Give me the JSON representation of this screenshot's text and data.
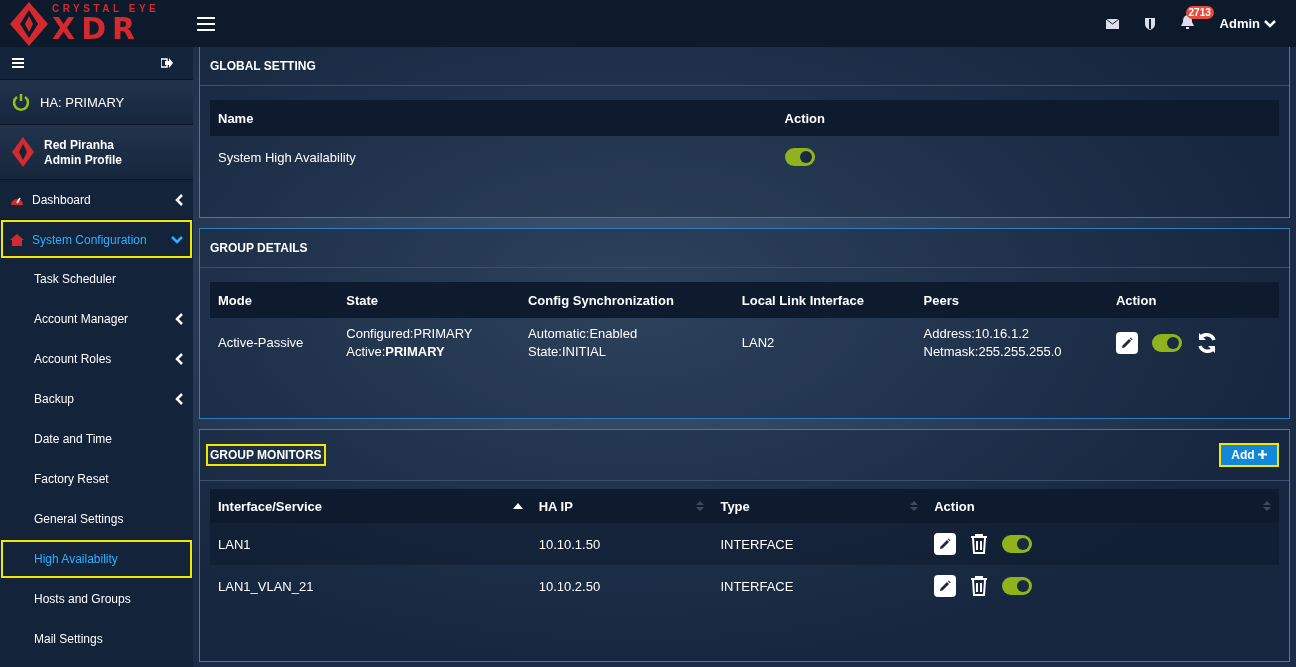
{
  "logo": {
    "tagline": "CRYSTAL EYE",
    "wordmark": "XDR"
  },
  "topbar": {
    "notifications": "2713",
    "user": "Admin"
  },
  "sidebar": {
    "ha_status": "HA: PRIMARY",
    "profile": {
      "name": "Red Piranha",
      "role": "Admin Profile"
    },
    "items": [
      {
        "label": "Dashboard",
        "kind": "group",
        "expanded": false,
        "selected": false,
        "highlighted": false
      },
      {
        "label": "System Configuration",
        "kind": "group",
        "expanded": true,
        "selected": true,
        "highlighted": true,
        "children": [
          {
            "label": "Task Scheduler",
            "kind": "link",
            "selected": false,
            "highlighted": false
          },
          {
            "label": "Account Manager",
            "kind": "group",
            "expanded": false,
            "selected": false,
            "highlighted": false
          },
          {
            "label": "Account Roles",
            "kind": "group",
            "expanded": false,
            "selected": false,
            "highlighted": false
          },
          {
            "label": "Backup",
            "kind": "group",
            "expanded": false,
            "selected": false,
            "highlighted": false
          },
          {
            "label": "Date and Time",
            "kind": "link",
            "selected": false,
            "highlighted": false
          },
          {
            "label": "Factory Reset",
            "kind": "link",
            "selected": false,
            "highlighted": false
          },
          {
            "label": "General Settings",
            "kind": "link",
            "selected": false,
            "highlighted": false
          },
          {
            "label": "High Availability",
            "kind": "link",
            "selected": true,
            "highlighted": true
          },
          {
            "label": "Hosts and Groups",
            "kind": "link",
            "selected": false,
            "highlighted": false
          },
          {
            "label": "Mail Settings",
            "kind": "link",
            "selected": false,
            "highlighted": false
          }
        ]
      }
    ]
  },
  "global_setting": {
    "title": "GLOBAL SETTING",
    "columns": [
      "Name",
      "Action"
    ],
    "rows": [
      {
        "name": "System High Availability",
        "on": true
      }
    ]
  },
  "group_details": {
    "title": "GROUP DETAILS",
    "columns": [
      "Mode",
      "State",
      "Config Synchronization",
      "Local Link Interface",
      "Peers",
      "Action"
    ],
    "rows": [
      {
        "mode": "Active-Passive",
        "state": [
          "Configured:PRIMARY",
          "Active:**PRIMARY**"
        ],
        "sync": [
          "Automatic:Enabled",
          "State:INITIAL"
        ],
        "interface": "LAN2",
        "peers": [
          "Address:10.16.1.2",
          "Netmask:255.255.255.0"
        ],
        "on": true
      }
    ]
  },
  "group_monitors": {
    "title": "GROUP MONITORS",
    "title_highlighted": true,
    "add_button": "Add",
    "add_highlighted": true,
    "columns": [
      {
        "label": "Interface/Service",
        "sorted": true
      },
      {
        "label": "HA IP",
        "sorted": false
      },
      {
        "label": "Type",
        "sorted": false
      },
      {
        "label": "Action",
        "sorted": false
      }
    ],
    "rows": [
      {
        "name": "LAN1",
        "ip": "10.10.1.50",
        "type": "INTERFACE",
        "on": true
      },
      {
        "name": "LAN1_VLAN_21",
        "ip": "10.10.2.50",
        "type": "INTERFACE",
        "on": true
      }
    ]
  }
}
